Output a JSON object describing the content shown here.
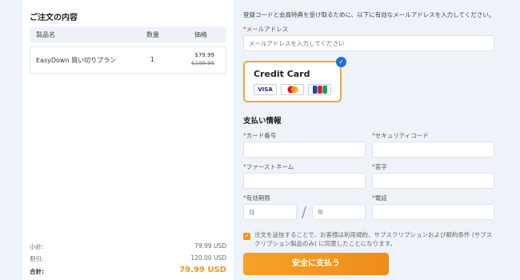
{
  "order": {
    "title": "ご注文の内容",
    "columns": {
      "product": "製品名",
      "quantity": "数量",
      "price": "価格"
    },
    "items": [
      {
        "name": "EasyDown 買い切りプラン",
        "quantity": "1",
        "price": "$79.99",
        "original_price": "$199.99"
      }
    ],
    "summary": {
      "subtotal_label": "小計:",
      "subtotal_value": "79.99 USD",
      "discount_label": "割引:",
      "discount_value": "120.00 USD",
      "total_label": "合計:",
      "total_value": "79.99 USD"
    }
  },
  "form": {
    "notice": "登録コードと会員特典を受け取るために、以下に有効なメールアドレスを入力してください。",
    "email_label": "メールアドレス",
    "email_placeholder": "メールアドレスを入力してください",
    "payment_method": {
      "title": "Credit Card",
      "brands": [
        "VISA",
        "Mastercard",
        "JCB"
      ],
      "selected": true
    },
    "payment_info_title": "支払い情報",
    "card_number_label": "カード番号",
    "security_code_label": "セキュリティコード",
    "first_name_label": "ファーストネーム",
    "last_name_label": "苗字",
    "expiry_label": "有効期限",
    "month_placeholder": "月",
    "year_placeholder": "年",
    "phone_label": "電話",
    "agreement_checked": true,
    "agreement_text": "注文を送信することで、お客様は利用規約、サブスクリプションおよび解約条件 (サブスクリプション製品のみ) に同意したことになります。",
    "submit_label": "安全に支払う"
  },
  "colors": {
    "accent": "#f3941e",
    "selected_check": "#1f6fd8",
    "required": "#e53935"
  }
}
